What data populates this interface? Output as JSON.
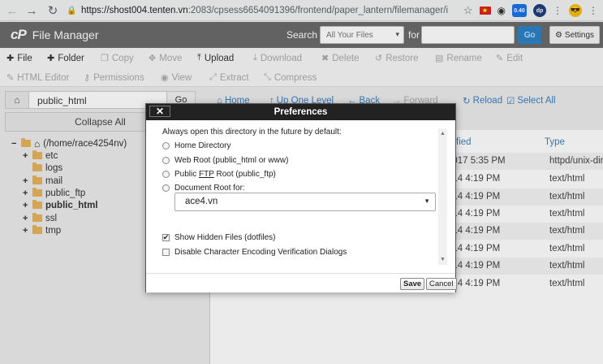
{
  "browser": {
    "url_host": "https://shost004.tenten.vn",
    "url_path": ":2083/cpsess6654091396/frontend/paper_lantern/filemanager/i...",
    "ext_badge": "0.40",
    "ext_dp": "dp"
  },
  "header": {
    "logo": "cP",
    "title": "File Manager",
    "search_label": "Search",
    "search_scope": "All Your Files",
    "for_label": "for",
    "go_label": "Go",
    "settings_label": "Settings"
  },
  "toolbar": {
    "file": "File",
    "folder": "Folder",
    "copy": "Copy",
    "move": "Move",
    "upload": "Upload",
    "download": "Download",
    "delete": "Delete",
    "restore": "Restore",
    "rename": "Rename",
    "edit": "Edit",
    "html_editor": "HTML Editor",
    "permissions": "Permissions",
    "view": "View",
    "extract": "Extract",
    "compress": "Compress"
  },
  "left": {
    "path_value": "public_html",
    "go_label": "Go",
    "collapse_label": "Collapse All",
    "root_label": "(/home/race4254nv)",
    "tree": [
      {
        "label": "etc",
        "expander": "+"
      },
      {
        "label": "logs",
        "expander": ""
      },
      {
        "label": "mail",
        "expander": "+"
      },
      {
        "label": "public_ftp",
        "expander": "+"
      },
      {
        "label": "public_html",
        "expander": "+"
      },
      {
        "label": "ssl",
        "expander": "+"
      },
      {
        "label": "tmp",
        "expander": "+"
      }
    ]
  },
  "right": {
    "home": "Home",
    "up": "Up One Level",
    "back": "Back",
    "forward": "Forward",
    "reload": "Reload",
    "select_all": "Select All",
    "col_modified": "fied",
    "col_type": "Type",
    "rows": [
      {
        "modified": "2017 5:35 PM",
        "type": "httpd/unix-dire"
      },
      {
        "modified": "014 4:19 PM",
        "type": "text/html"
      },
      {
        "modified": "014 4:19 PM",
        "type": "text/html"
      },
      {
        "modified": "014 4:19 PM",
        "type": "text/html"
      },
      {
        "modified": "014 4:19 PM",
        "type": "text/html"
      },
      {
        "modified": "014 4:19 PM",
        "type": "text/html"
      },
      {
        "modified": "014 4:19 PM",
        "type": "text/html"
      },
      {
        "modified": "014 4:19 PM",
        "type": "text/html"
      }
    ]
  },
  "modal": {
    "title": "Preferences",
    "close": "✕",
    "intro": "Always open this directory in the future by default:",
    "opt_home": "Home Directory",
    "opt_web": "Web Root (public_html or www)",
    "opt_ftp_prefix": "Public ",
    "opt_ftp_u": "FTP",
    "opt_ftp_suffix": " Root (public_ftp)",
    "opt_doc": "Document Root for:",
    "doc_value": "ace4.vn",
    "show_hidden": "Show Hidden Files (dotfiles)",
    "disable_enc": "Disable Character Encoding Verification Dialogs",
    "save": "Save",
    "cancel": "Cancel"
  }
}
